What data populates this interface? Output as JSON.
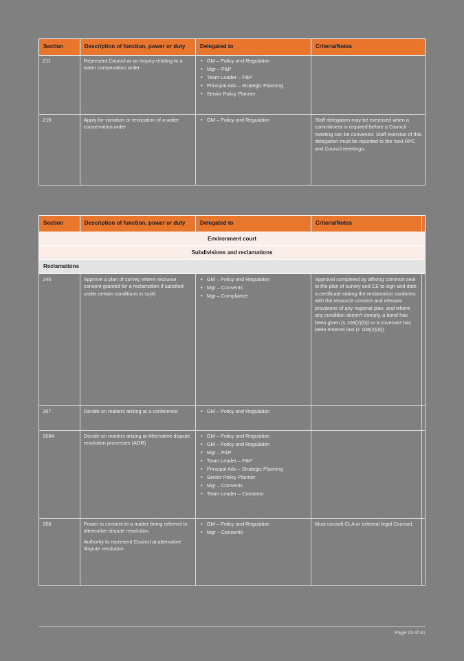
{
  "document": {
    "page_footer": "Page 23 of 41",
    "accent_color": "#e8762c",
    "band_color": "#fbeee8",
    "subband_color": "#e4e4e4"
  },
  "columns": {
    "section": "Section",
    "description": "Description of function, power or duty",
    "delegated_to": "Delegated to",
    "criteria": "Criteria/Notes"
  },
  "table_one": {
    "rows": [
      {
        "section": "211",
        "description": "Represent Council at an inquiry relating to a water conservation order",
        "delegated_to": [
          "GM – Policy and Regulation",
          "Mgr – P&P",
          "Team Leader – P&P",
          "Principal Adv – Strategic Planning",
          "Senior Policy Planner"
        ],
        "criteria": ""
      },
      {
        "section": "216",
        "description": "Apply for variation or revocation of a water conservation order",
        "delegated_to": [
          "GM – Policy and Regulation"
        ],
        "criteria": "Staff delegation may be exercised when a commitment is required before a Council meeting can be convened. Staff exercise of this delegation must be reported to the next RPC and Council meetings."
      }
    ]
  },
  "table_two": {
    "bands": {
      "environment_court": "Environment court",
      "subdivisions_and_reclamations": "Subdivisions and reclamations",
      "reclamations": "Reclamations"
    },
    "rows": [
      {
        "section": "245",
        "description": "Approve a plan of survey where resource consent granted for a reclamation if satisfied under certain conditions in ss(4)",
        "delegated_to": [
          "GM – Policy and Regulation",
          "Mgr – Consents",
          "Mgr – Compliance"
        ],
        "criteria": "Approval completed by affixing common seal to the plan of survey and CE to sign and date a certificate stating the reclamation conforms with the resource consent and relevant provisions of any regional plan, and where any condition doesn’t comply, a bond has been given (s 108(2)(b)) or a covenant has been entered into (s 108(2)(d))."
      },
      {
        "section": "267",
        "description": "Decide on matters arising at a conference",
        "delegated_to": [
          "GM – Policy and Regulation"
        ],
        "criteria": ""
      },
      {
        "section": "268A",
        "description": "Decide on matters arising at Alternative dispute resolution processes (ADR)",
        "delegated_to": [
          "GM – Policy and Regulation",
          "GM – Policy and Regulation",
          "Mgr – P&P",
          "Team Leader – P&P",
          "Principal Adv – Strategic Planning",
          "Senior Policy Planner",
          "Mgr – Consents",
          "Team Leader – Consents"
        ],
        "criteria": ""
      },
      {
        "section": "268",
        "description_paragraphs": [
          "Power to consent to a matter being referred to alternative dispute resolution.",
          "Authority to represent Council at alternative dispute resolution."
        ],
        "delegated_to": [
          "GM – Policy and Regulation",
          "Mgr – Consents"
        ],
        "criteria": "Must consult CLA or external legal Counsel."
      }
    ]
  }
}
